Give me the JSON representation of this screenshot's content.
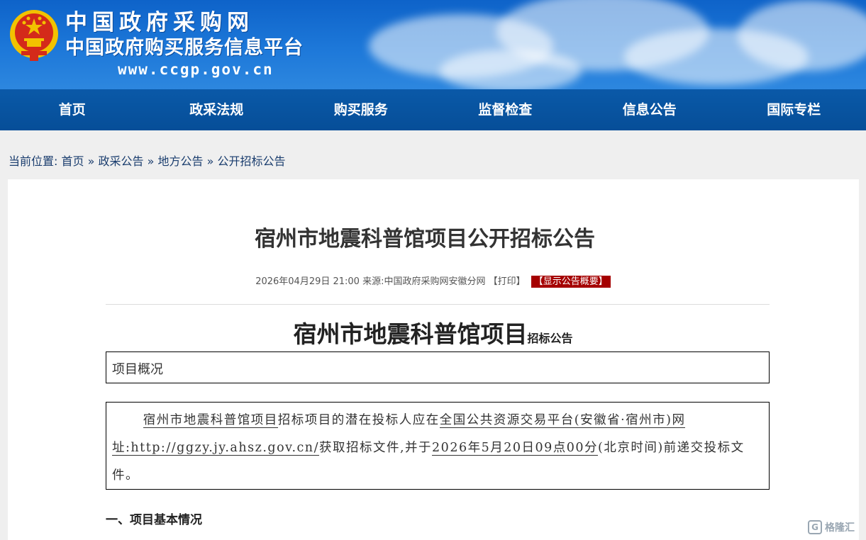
{
  "header": {
    "site_name": "中国政府采购网",
    "site_subtitle": "中国政府购买服务信息平台",
    "site_url": "www.ccgp.gov.cn"
  },
  "nav": {
    "items": [
      {
        "label": "首页"
      },
      {
        "label": "政采法规"
      },
      {
        "label": "购买服务"
      },
      {
        "label": "监督检查"
      },
      {
        "label": "信息公告"
      },
      {
        "label": "国际专栏"
      }
    ]
  },
  "breadcrumb": {
    "prefix": "当前位置:",
    "items": [
      {
        "label": "首页"
      },
      {
        "label": "政采公告"
      },
      {
        "label": "地方公告"
      },
      {
        "label": "公开招标公告"
      }
    ],
    "separator": "»"
  },
  "article": {
    "title": "宿州市地震科普馆项目公开招标公告",
    "meta_date": "2026年04月29日 21:00",
    "meta_source": "来源:中国政府采购网安徽分网",
    "print_label": "【打印】",
    "summary_label": "【显示公告概要】",
    "doc_title_big": "宿州市地震科普馆项目",
    "doc_title_small": "招标公告",
    "overview_heading": "项目概况",
    "p_project": "宿州市地震科普馆项目",
    "p_text1": "招标项目的潜在投标人应在",
    "p_platform": "全国公共资源交易平台(安徽省·宿州市)网址:http://ggzy.jy.ahsz.gov.cn/",
    "p_text2": "获取招标文件,并于",
    "p_deadline": "2026年5月20日09点00分",
    "p_text3": "(北京时间)前递交投标文件。",
    "section1": "一、项目基本情况"
  },
  "watermark": {
    "text": "格隆汇",
    "mark": "G"
  },
  "colors": {
    "banner": "#1d78d9",
    "nav": "#064e98",
    "accent_red": "#a50000"
  }
}
